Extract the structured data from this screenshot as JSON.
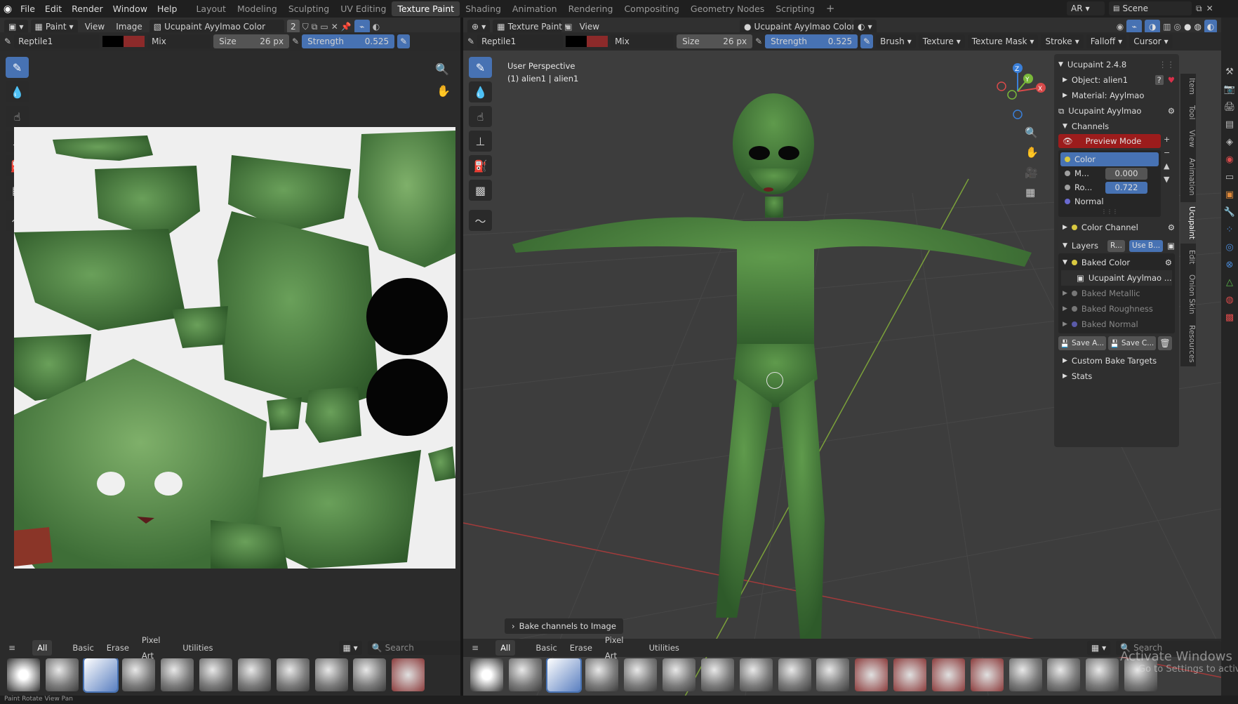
{
  "menu": [
    "File",
    "Edit",
    "Render",
    "Window",
    "Help"
  ],
  "workspaces": [
    "Layout",
    "Modeling",
    "Sculpting",
    "UV Editing",
    "Texture Paint",
    "Shading",
    "Animation",
    "Rendering",
    "Compositing",
    "Geometry Nodes",
    "Scripting"
  ],
  "active_workspace": "Texture Paint",
  "top_right": {
    "language": "AR",
    "scene": "Scene"
  },
  "image_editor": {
    "mode": "Paint",
    "menus": [
      "View",
      "Image"
    ],
    "image_name": "Ucupaint Ayylmao Color",
    "users": "2",
    "brush": "Reptile1",
    "blend": "Mix",
    "size_label": "Size",
    "size_value": "26 px",
    "strength_label": "Strength",
    "strength_value": "0.525"
  },
  "viewport": {
    "mode": "Texture Paint",
    "menus": [
      "View"
    ],
    "shading_label": "Ucupaint Ayylmao Color",
    "brush": "Reptile1",
    "blend": "Mix",
    "size_label": "Size",
    "size_value": "26 px",
    "strength_label": "Strength",
    "strength_value": "0.525",
    "header_menus": [
      "Brush",
      "Texture",
      "Texture Mask",
      "Stroke",
      "Falloff",
      "Cursor"
    ],
    "perspective": "User Perspective",
    "object_info": "(1) alien1 | alien1",
    "operator_panel": "Bake channels to Image",
    "gizmo_axes": {
      "x": "X",
      "y": "Y",
      "z": "Z"
    }
  },
  "sidebar_tabs": [
    "Item",
    "Tool",
    "View",
    "Animation",
    "Ucupaint",
    "Edit",
    "Onion Skin",
    "Resources"
  ],
  "active_sidebar_tab": "Ucupaint",
  "ucupaint": {
    "title": "Ucupaint 2.4.8",
    "object": "Object: alien1",
    "material": "Material: Ayylmao",
    "node": "Ucupaint Ayylmao",
    "channels_label": "Channels",
    "preview_mode": "Preview Mode",
    "channels": [
      {
        "name": "Color",
        "value": "",
        "color": "#d8c840"
      },
      {
        "name": "M...",
        "value": "0.000",
        "color": "#a0a0a0"
      },
      {
        "name": "Ro...",
        "value": "0.722",
        "color": "#a0a0a0"
      },
      {
        "name": "Normal",
        "value": "",
        "color": "#6a6ad0"
      }
    ],
    "color_channel": "Color Channel",
    "layers_label": "Layers",
    "layers_btn_r": "R...",
    "layers_btn_use": "Use B...",
    "layers": [
      {
        "name": "Baked Color",
        "enabled": true
      },
      {
        "name": "Ucupaint Ayylmao ...",
        "enabled": true,
        "is_image": true
      },
      {
        "name": "Baked Metallic",
        "enabled": false
      },
      {
        "name": "Baked Roughness",
        "enabled": false
      },
      {
        "name": "Baked Normal",
        "enabled": false
      }
    ],
    "save_a": "Save A...",
    "save_c": "Save C...",
    "custom_bake_targets": "Custom Bake Targets",
    "stats": "Stats"
  },
  "asset_shelf": {
    "categories": [
      "All",
      "Basic",
      "Erase",
      "Pixel Art",
      "Utilities"
    ],
    "search_placeholder": "Search"
  },
  "watermark": {
    "line1": "Activate Windows",
    "line2": "Go to Settings to activate"
  },
  "status_bar": {
    "left_text": "Paint  Rotate View  Pan"
  },
  "colors": {
    "accent": "#4772b3",
    "preview_red": "#9c1c1c",
    "secondary_color": "#8c2a2a"
  }
}
